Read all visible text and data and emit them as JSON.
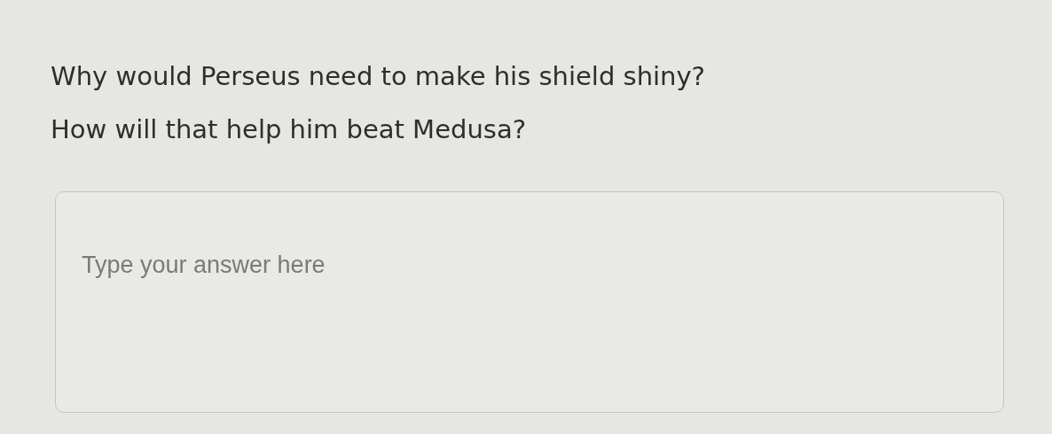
{
  "question": {
    "lines": [
      "Why would Perseus need to make his shield shiny?",
      "How will that help him beat Medusa?"
    ]
  },
  "answer": {
    "placeholder": "Type your answer here"
  }
}
